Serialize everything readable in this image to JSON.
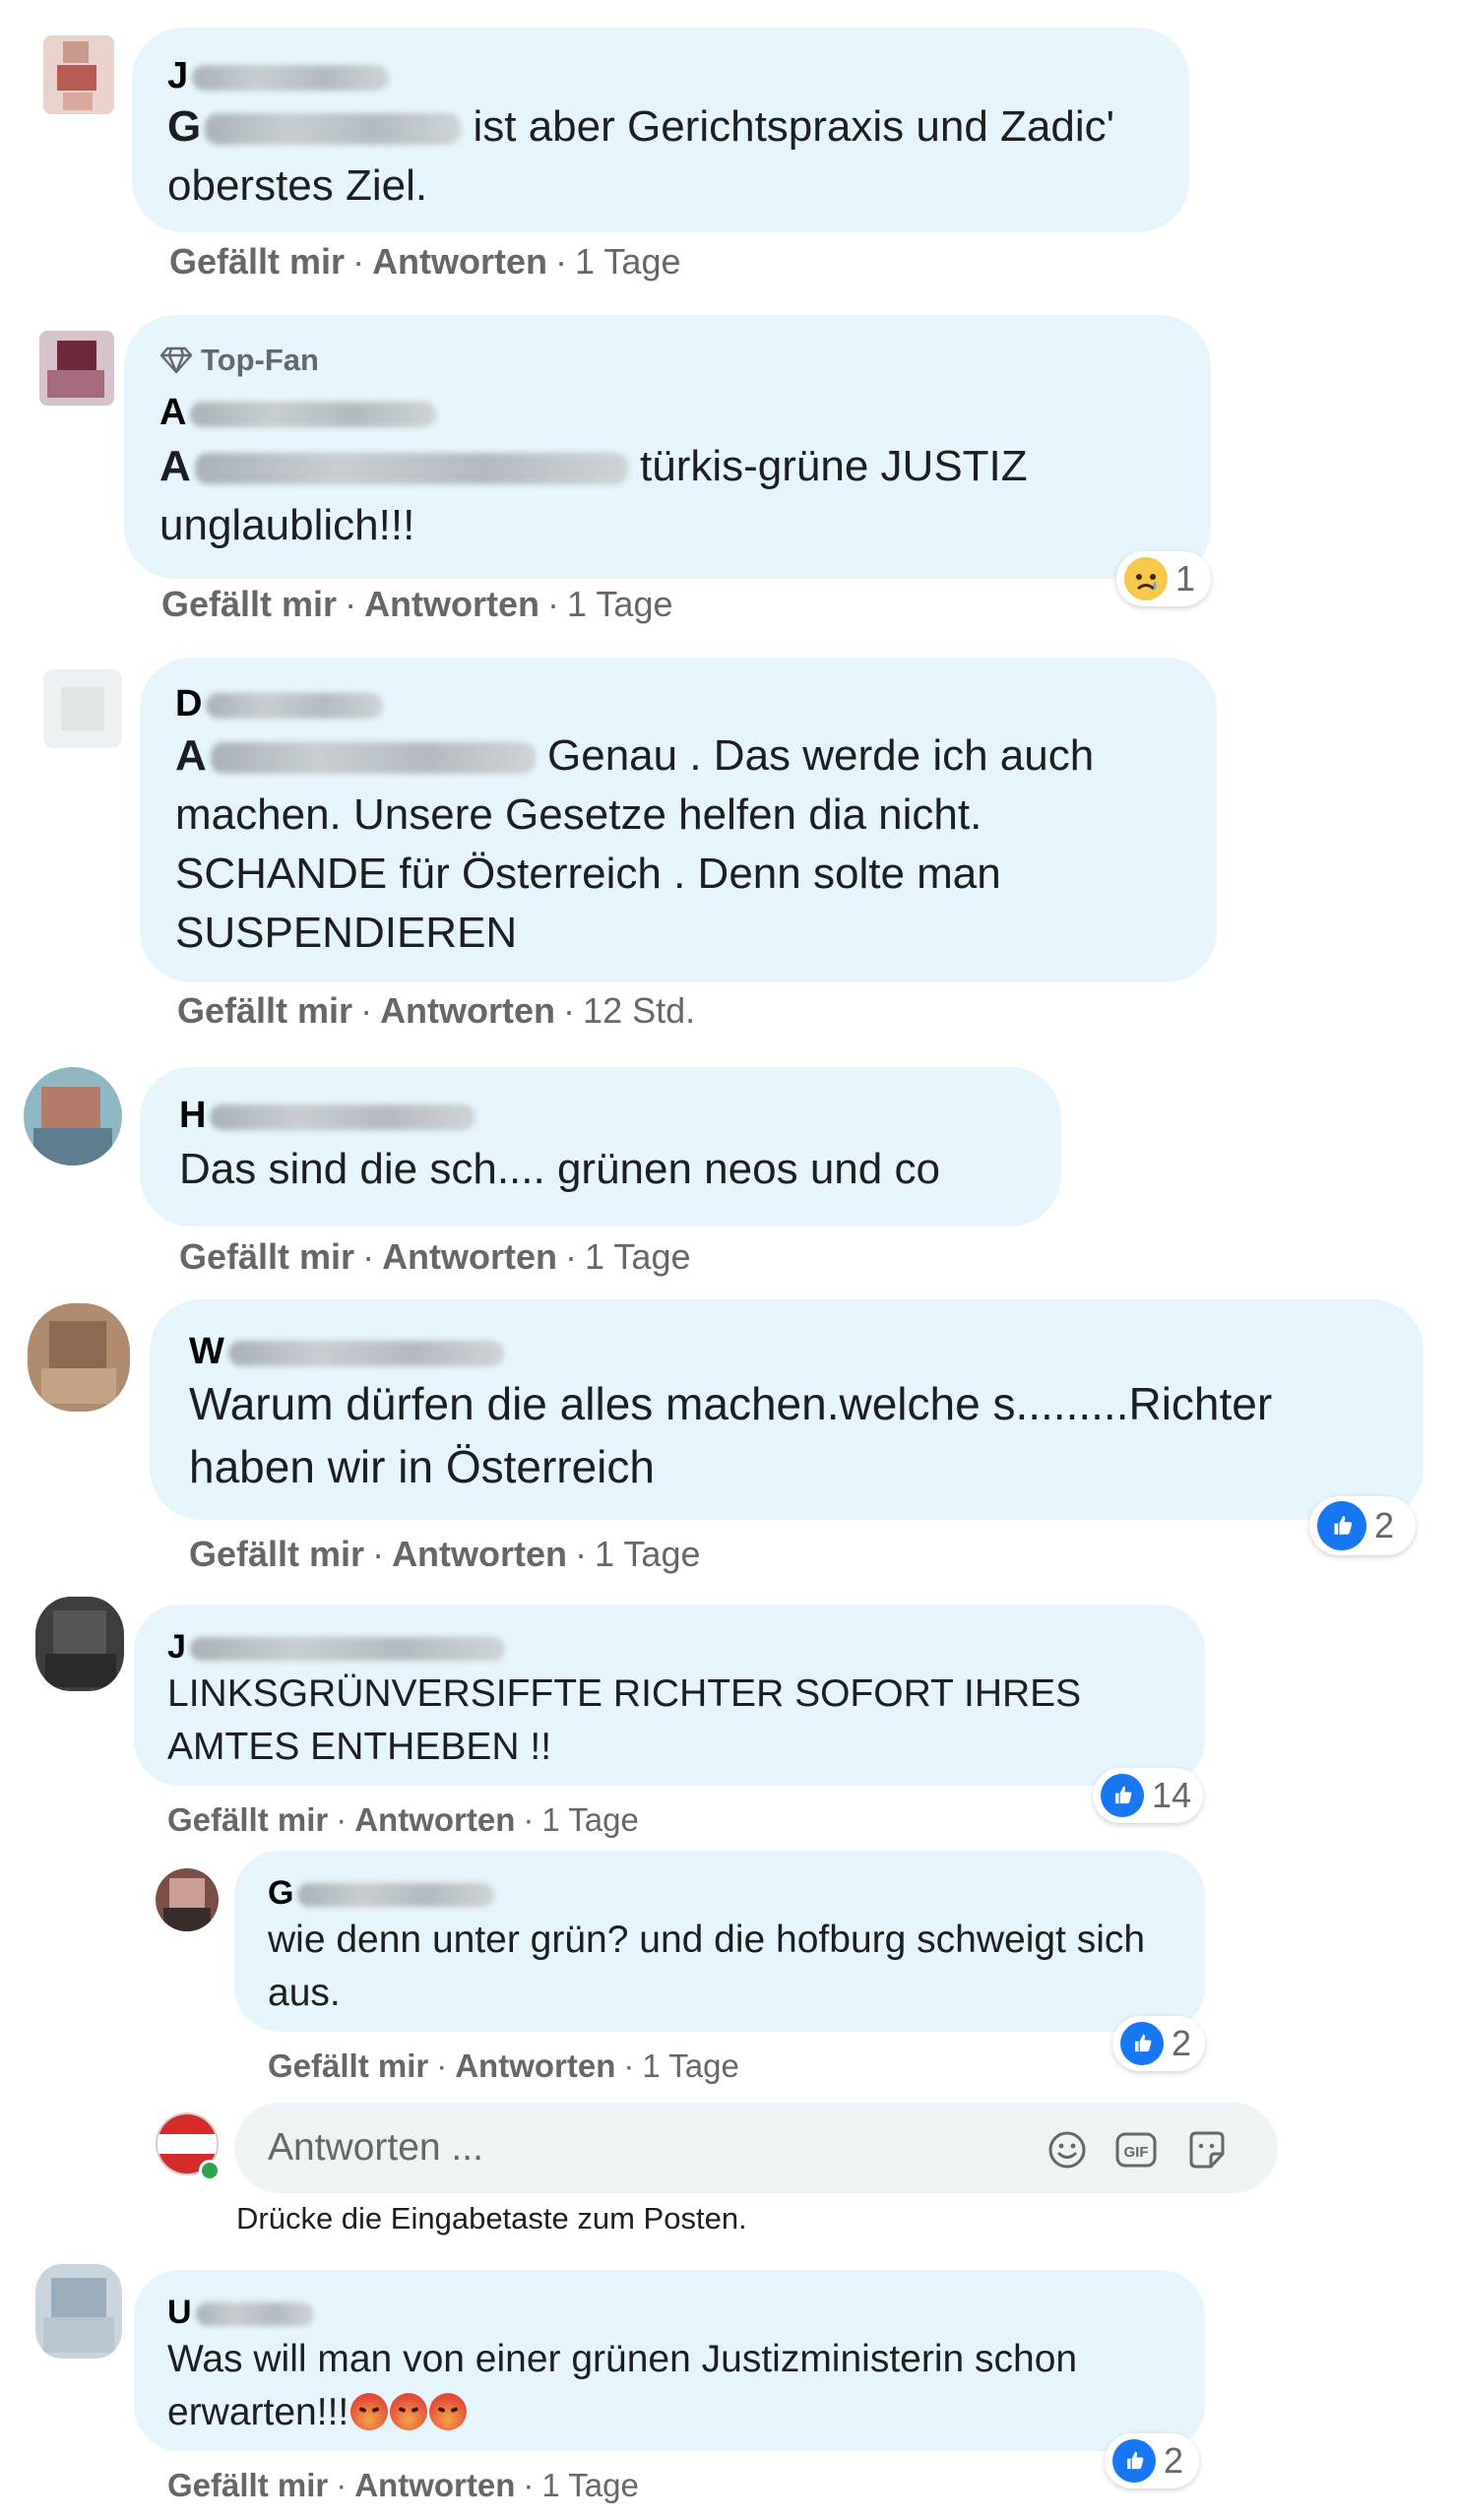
{
  "colors": {
    "bubble": "#e6f5fb",
    "like_blue": "#1877f2",
    "meta_gray": "#65676b"
  },
  "actions": {
    "like": "Gefällt mir",
    "reply": "Antworten",
    "dot": "·"
  },
  "comments": [
    {
      "name_initial": "J",
      "mention_initial": "G",
      "text": "ist aber Gerichtspraxis und Zadic' oberstes Ziel.",
      "time": "1 Tage"
    },
    {
      "badge": "Top-Fan",
      "badge_icon": "diamond-icon",
      "name_initial": "A",
      "mention_initial": "A",
      "text": "türkis-grüne JUSTIZ unglaublich!!!",
      "time": "1 Tage",
      "reaction": {
        "icon": "sad-reaction-icon",
        "count": "1"
      }
    },
    {
      "name_initial": "D",
      "mention_initial": "A",
      "text": "Genau . Das werde ich auch machen. Unsere Gesetze helfen dia nicht. SCHANDE für Österreich . Denn solte man SUSPENDIEREN",
      "time": "12 Std."
    },
    {
      "name_initial": "H",
      "text": "Das sind die sch.... grünen neos und co",
      "time": "1 Tage"
    },
    {
      "name_initial": "W",
      "text": "Warum dürfen die alles machen.welche s.........Richter haben wir in Österreich",
      "time": "1 Tage",
      "reaction": {
        "icon": "like-reaction-icon",
        "count": "2"
      }
    },
    {
      "name_initial": "J",
      "text": "LINKSGRÜNVERSIFFTE RICHTER SOFORT IHRES AMTES ENTHEBEN !!",
      "time": "1 Tage",
      "reaction": {
        "icon": "like-reaction-icon",
        "count": "14"
      }
    },
    {
      "name_initial": "G",
      "text": "wie denn unter grün? und die hofburg schweigt sich aus.",
      "time": "1 Tage",
      "reaction": {
        "icon": "like-reaction-icon",
        "count": "2"
      }
    },
    {
      "name_initial": "U",
      "text": "Was will man von einer grünen Justizministerin schon erwarten!!!",
      "time": "1 Tage",
      "reaction": {
        "icon": "like-reaction-icon",
        "count": "2"
      }
    }
  ],
  "reply_box": {
    "placeholder": "Antworten ...",
    "hint": "Drücke die Eingabetaste zum Posten.",
    "icons": [
      "emoji-icon",
      "gif-icon",
      "sticker-icon"
    ]
  }
}
